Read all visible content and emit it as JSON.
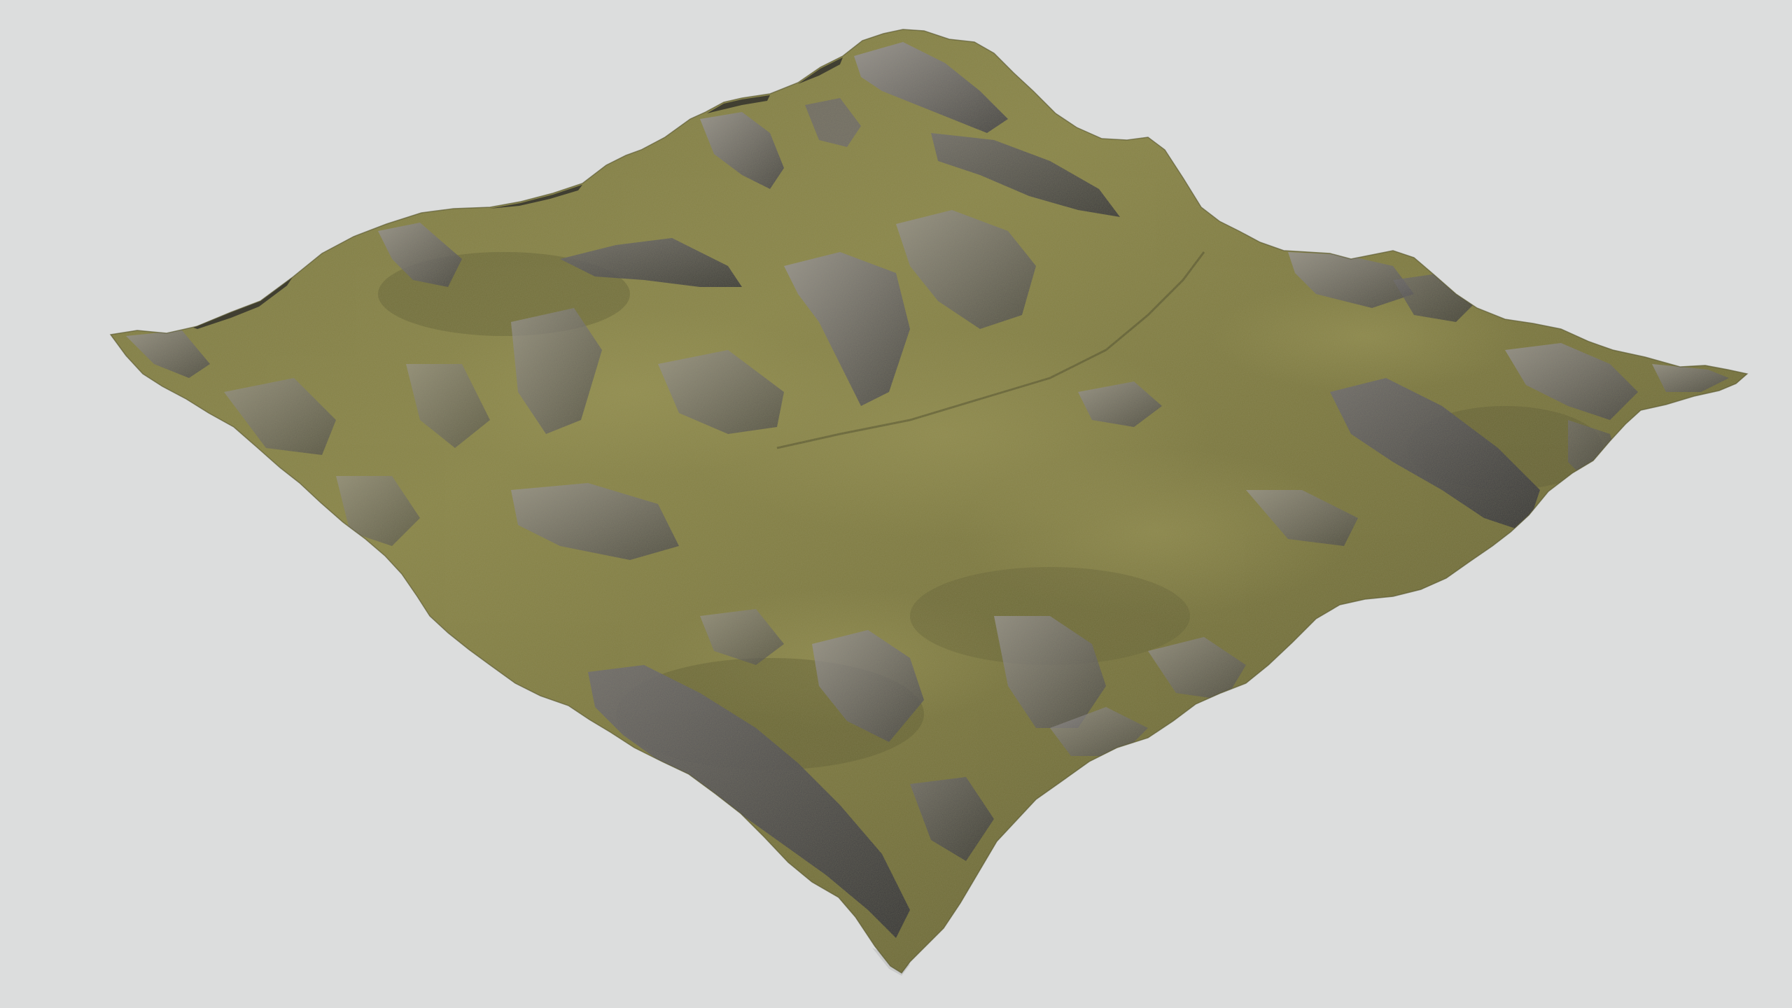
{
  "scene": {
    "background_color": "#dcdddd",
    "subject": "terrain-mesh",
    "palette": {
      "grass_light": "#8a8648",
      "grass_mid": "#6f6c3a",
      "grass_dark": "#55532c",
      "rock_light": "#8f8b8e",
      "rock_mid": "#6a676c",
      "rock_dark": "#3f3e44",
      "edge_shadow": "#2e2d2a"
    }
  }
}
